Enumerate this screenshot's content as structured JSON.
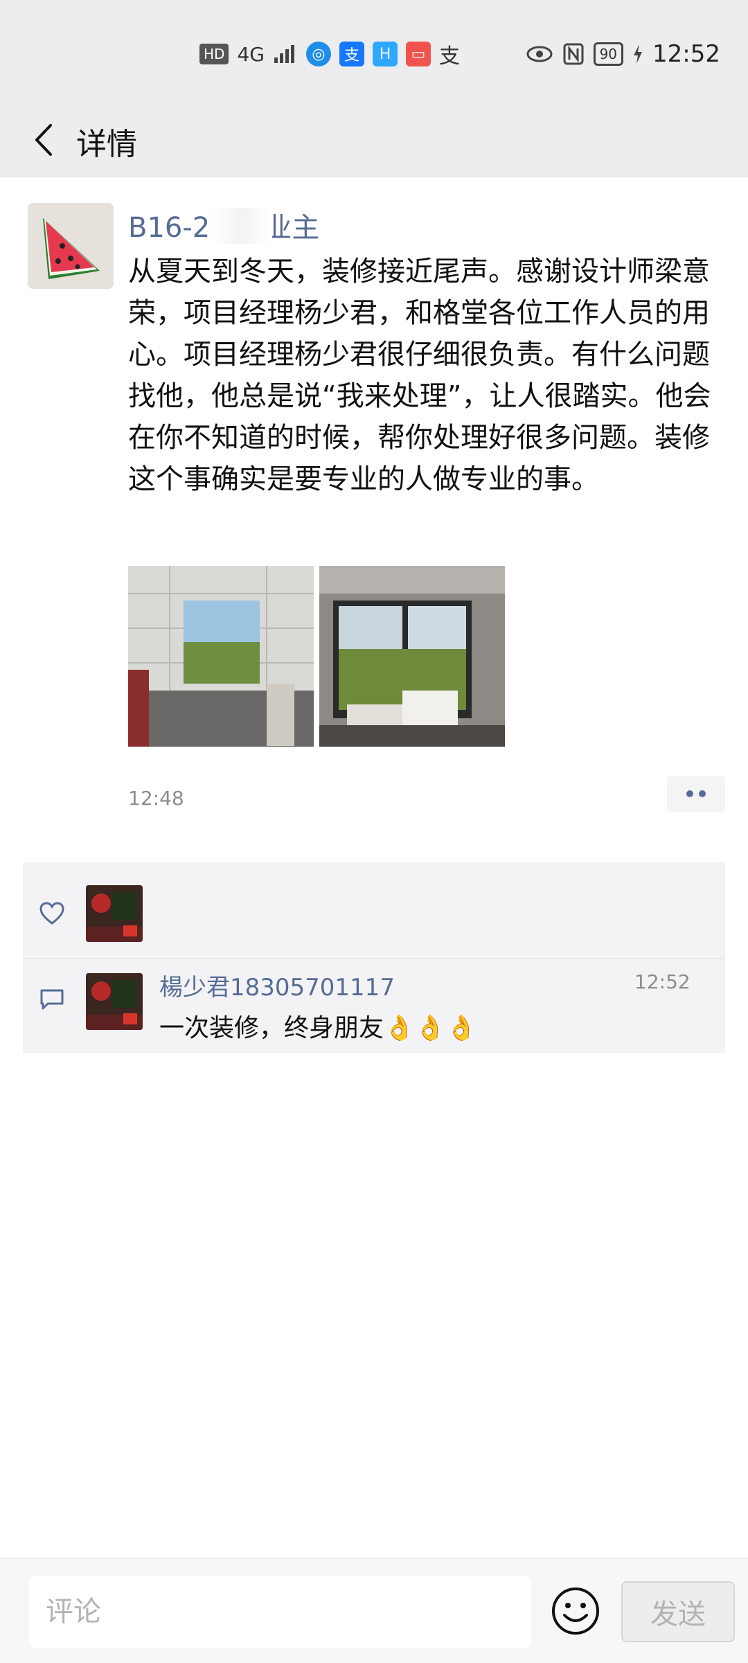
{
  "status_bar": {
    "hd": "HD",
    "network": "4G",
    "app_icons": [
      "支",
      "H",
      "支"
    ],
    "battery": "90",
    "time": "12:52"
  },
  "header": {
    "title": "详情"
  },
  "post": {
    "author": "B16-2 3女业主",
    "text": "从夏天到冬天，装修接近尾声。感谢设计师梁意荣，项目经理杨少君，和格堂各位工作人员的用心。项目经理杨少君很仔细很负责。有什么问题找他，他总是说“我来处理”，让人很踏实。他会在你不知道的时候，帮你处理好很多问题。装修这个事确实是要专业的人做专业的事。",
    "time": "12:48",
    "photo_count": 2
  },
  "likes": {
    "count": 1
  },
  "comments": [
    {
      "name": "楊少君18305701117",
      "time": "12:52",
      "text": "一次装修，终身朋友👌👌👌"
    }
  ],
  "composer": {
    "placeholder": "评论",
    "send_label": "发送"
  },
  "colors": {
    "link_blue": "#576b95",
    "bg_gray": "#ededed"
  }
}
